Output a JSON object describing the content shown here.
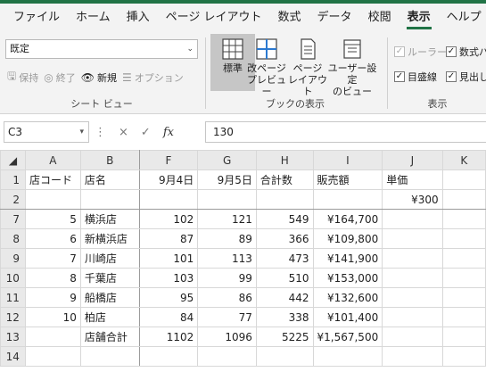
{
  "ribbon": {
    "tabs": [
      {
        "label": "ファイル"
      },
      {
        "label": "ホーム"
      },
      {
        "label": "挿入"
      },
      {
        "label": "ページ レイアウト"
      },
      {
        "label": "数式"
      },
      {
        "label": "データ"
      },
      {
        "label": "校閲"
      },
      {
        "label": "表示",
        "active": true
      },
      {
        "label": "ヘルプ"
      }
    ],
    "sheet_view": {
      "select_value": "既定",
      "keep": "保持",
      "exit": "終了",
      "new": "新規",
      "options": "オプション",
      "group_label": "シート ビュー"
    },
    "workbook_views": {
      "normal": "標準",
      "page_break_line1": "改ページ",
      "page_break_line2": "プレビュー",
      "page_layout_line1": "ページ",
      "page_layout_line2": "レイアウト",
      "custom_line1": "ユーザー設定",
      "custom_line2": "のビュー",
      "group_label": "ブックの表示"
    },
    "show": {
      "ruler": "ルーラー",
      "formula_bar": "数式バ",
      "gridlines": "目盛線",
      "headings": "見出し",
      "group_label": "表示"
    }
  },
  "formula_bar": {
    "name_box": "C3",
    "cancel_icon": "×",
    "enter_icon": "✓",
    "fx_icon": "fx",
    "value": "130"
  },
  "sheet": {
    "columns": [
      "A",
      "B",
      "F",
      "G",
      "H",
      "I",
      "J",
      "K"
    ],
    "rows": [
      {
        "row": "1",
        "cells": [
          "店コード",
          "店名",
          "9月4日",
          "9月5日",
          "合計数",
          "販売額",
          "単価",
          ""
        ]
      },
      {
        "row": "2",
        "cells": [
          "",
          "",
          "",
          "",
          "",
          "",
          "¥300",
          ""
        ]
      },
      {
        "row": "7",
        "cells": [
          "5",
          "横浜店",
          "102",
          "121",
          "549",
          "¥164,700",
          "",
          ""
        ]
      },
      {
        "row": "8",
        "cells": [
          "6",
          "新横浜店",
          "87",
          "89",
          "366",
          "¥109,800",
          "",
          ""
        ]
      },
      {
        "row": "9",
        "cells": [
          "7",
          "川崎店",
          "101",
          "113",
          "473",
          "¥141,900",
          "",
          ""
        ]
      },
      {
        "row": "10",
        "cells": [
          "8",
          "千葉店",
          "103",
          "99",
          "510",
          "¥153,000",
          "",
          ""
        ]
      },
      {
        "row": "11",
        "cells": [
          "9",
          "船橋店",
          "95",
          "86",
          "442",
          "¥132,600",
          "",
          ""
        ]
      },
      {
        "row": "12",
        "cells": [
          "10",
          "柏店",
          "84",
          "77",
          "338",
          "¥101,400",
          "",
          ""
        ]
      },
      {
        "row": "13",
        "cells": [
          "",
          "店舗合計",
          "1102",
          "1096",
          "5225",
          "¥1,567,500",
          "",
          ""
        ]
      },
      {
        "row": "14",
        "cells": [
          "",
          "",
          "",
          "",
          "",
          "",
          "",
          ""
        ]
      }
    ]
  }
}
